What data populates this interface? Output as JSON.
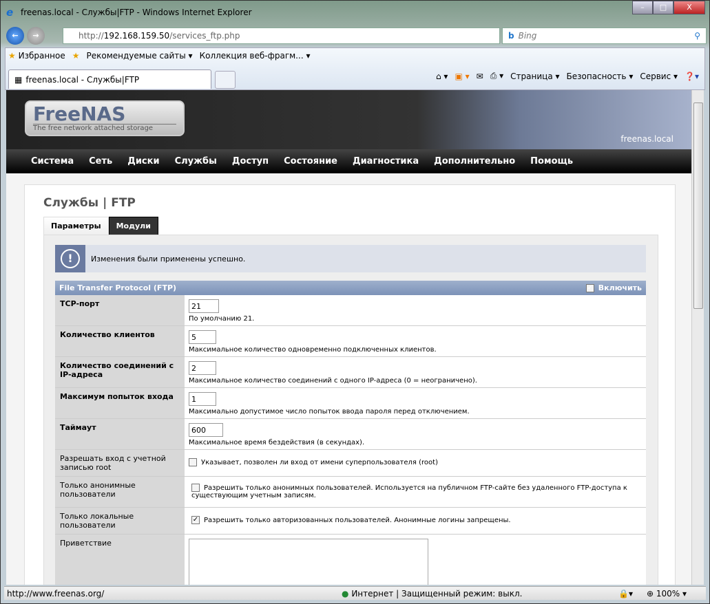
{
  "window": {
    "title": "freenas.local - Службы|FTP - Windows Internet Explorer",
    "min": "–",
    "max": "□",
    "close": "X"
  },
  "address": {
    "prefix": "http://",
    "host": "192.168.159.50",
    "path": "/services_ftp.php",
    "search_placeholder": "Bing"
  },
  "favorites": {
    "label": "Избранное",
    "items": [
      "Рекомендуемые сайты ▾",
      "Коллекция веб-фрагм... ▾"
    ]
  },
  "tab": {
    "label": "freenas.local - Службы|FTP"
  },
  "commands": [
    "Страница ▾",
    "Безопасность ▾",
    "Сервис ▾"
  ],
  "site": {
    "logo": "FreeNAS",
    "logo_sub": "The free network attached storage",
    "host": "freenas.local",
    "menu": [
      "Система",
      "Сеть",
      "Диски",
      "Службы",
      "Доступ",
      "Состояние",
      "Диагностика",
      "Дополнительно",
      "Помощь"
    ]
  },
  "page": {
    "title": "Службы | FTP",
    "tabs": [
      "Параметры",
      "Модули"
    ],
    "message": "Изменения были применены успешно.",
    "section": "File Transfer Protocol (FTP)",
    "enable_label": "Включить",
    "enable_checked": true,
    "fields": [
      {
        "label": "TCP-порт",
        "value": "21",
        "hint": "По умолчанию 21."
      },
      {
        "label": "Количество клиентов",
        "value": "5",
        "hint": "Максимальное количество одновременно подключенных клиентов."
      },
      {
        "label": "Количество соединений с IP-адреса",
        "value": "2",
        "hint": "Максимальное количество соединений с одного IP-адреса (0 = неограничено)."
      },
      {
        "label": "Максимум попыток входа",
        "value": "1",
        "hint": "Максимально допустимое число попыток ввода пароля перед отключением."
      },
      {
        "label": "Таймаут",
        "value": "600",
        "hint": "Максимальное время бездействия (в секундах)."
      }
    ],
    "checks": [
      {
        "label": "Разрешать вход с учетной записью root",
        "text": "Указывает, позволен ли вход от имени суперпользователя (root)",
        "checked": false
      },
      {
        "label": "Только анонимные пользователи",
        "text": "Разрешить только анонимных пользователей. Используется на публичном FTP-сайте без удаленного FTP-доступа к существующим учетным записям.",
        "checked": false
      },
      {
        "label": "Только локальные пользователи",
        "text": "Разрешить только авторизованных пользователей. Анонимные логины запрещены.",
        "checked": true
      }
    ],
    "greeting_label": "Приветствие"
  },
  "status": {
    "url": "http://www.freenas.org/",
    "zone": "Интернет | Защищенный режим: выкл.",
    "zoom": "100%"
  }
}
